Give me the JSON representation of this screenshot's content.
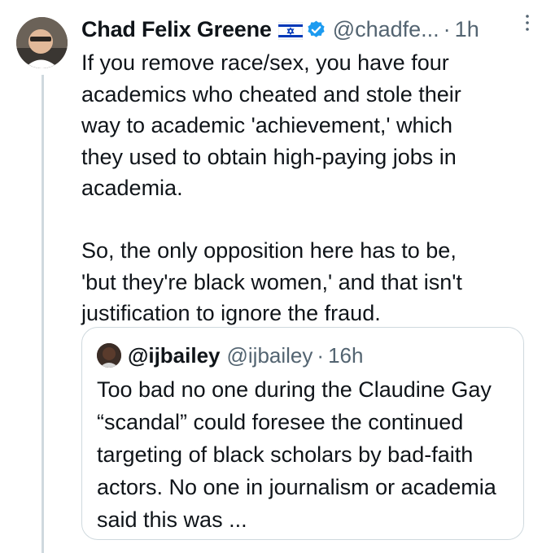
{
  "tweet": {
    "author_name": "Chad Felix Greene",
    "flag_emoji": "Israel flag",
    "handle": "@chadfe...",
    "separator": "·",
    "time": "1h",
    "text": "If you remove race/sex, you have four\nacademics who cheated and stole their\nway to academic 'achievement,' which\nthey used to obtain high-paying jobs in\nacademia.\n\nSo, the only opposition here has to be,\n'but they're black women,' and that isn't\njustification to ignore the fraud."
  },
  "quote": {
    "author_name": "@ijbailey",
    "handle": "@ijbailey",
    "separator": "·",
    "time": "16h",
    "text": "Too bad no one during the Claudine Gay “scandal” could foresee the continued targeting of black scholars by bad-faith actors. No one in journalism or academia said this was ..."
  },
  "icons": {
    "verified": "verified-badge-icon",
    "flag": "israel-flag-icon",
    "more": "more-options-icon"
  },
  "colors": {
    "verified": "#1d9bf0",
    "secondary_text": "#536471",
    "border": "#cfd9de"
  }
}
